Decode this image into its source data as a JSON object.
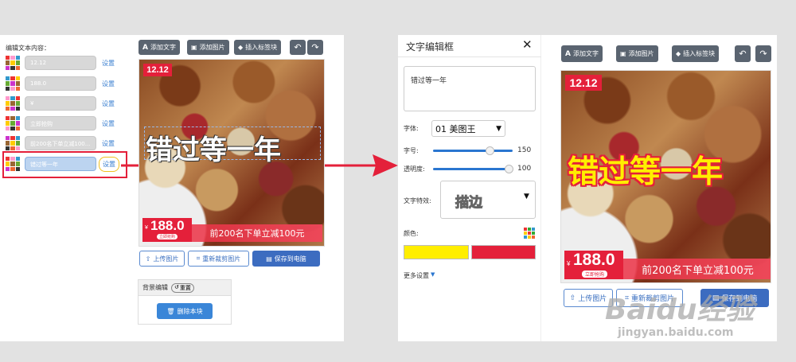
{
  "left": {
    "section_title": "编辑文本内容：",
    "text_rows": [
      {
        "value": "12.12",
        "set_label": "设置"
      },
      {
        "value": "188.0",
        "set_label": "设置"
      },
      {
        "value": "¥",
        "set_label": "设置"
      },
      {
        "value": "立即抢购",
        "set_label": "设置"
      },
      {
        "value": "前200名下单立减100...",
        "set_label": "设置"
      },
      {
        "value": "错过等一年",
        "set_label": "设置"
      }
    ]
  },
  "toolbar": {
    "add_text": "添加文字",
    "add_image": "添加图片",
    "insert_tag": "插入标签块",
    "undo_icon": "undo-icon",
    "redo_icon": "redo-icon"
  },
  "preview_left": {
    "badge": "12.12",
    "headline": "错过等一年",
    "price_symbol": "¥",
    "price": "188.0",
    "buy_now": "立即抢购",
    "promo": "前200名下单立减100元"
  },
  "actions": {
    "upload": "上传图片",
    "recrop": "重新裁剪图片",
    "save": "保存到电脑"
  },
  "bg_edit": {
    "title": "背景编辑",
    "reset": "重置",
    "delete": "删除本块"
  },
  "editor": {
    "title": "文字编辑框",
    "text_value": "错过等一年",
    "font_label": "字体:",
    "font_value": "01 美图王",
    "size_label": "字号:",
    "size_value": "150",
    "size_fraction": 0.8,
    "opacity_label": "透明度:",
    "opacity_value": "100",
    "opacity_fraction": 1.0,
    "effect_label": "文字特效:",
    "effect_value": "描边",
    "color_label": "颜色:",
    "colors": [
      "#ffee00",
      "#e4203a"
    ],
    "more_settings": "更多设置"
  },
  "preview_right": {
    "badge": "12.12",
    "headline": "错过等一年",
    "price_symbol": "¥",
    "price": "188.0",
    "buy_now": "立即抢购",
    "promo": "前200名下单立减100元",
    "upload": "上传图片",
    "recrop": "重新裁剪图片",
    "save": "保存到电脑"
  },
  "watermark": {
    "brand": "Baidu经验",
    "url": "jingyan.baidu.com"
  },
  "colors": {
    "accent_blue": "#3c6cc0",
    "promo_red": "#e4203a",
    "highlight_yellow": "#ffee00"
  }
}
